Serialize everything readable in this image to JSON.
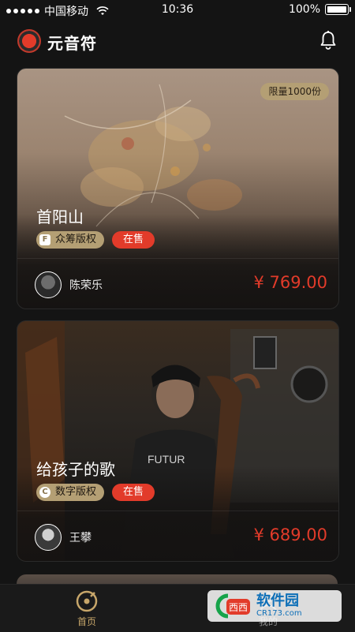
{
  "status_bar": {
    "carrier": "中国移动",
    "time": "10:36",
    "battery": "100%"
  },
  "header": {
    "app_name": "元音符"
  },
  "cards": [
    {
      "limit_badge": "限量1000份",
      "title": "首阳山",
      "rights_icon": "F",
      "rights_type": "众筹版权",
      "sale_status": "在售",
      "artist": "陈荣乐",
      "price": "¥ 769.00"
    },
    {
      "title": "给孩子的歌",
      "rights_icon": "C",
      "rights_type": "数字版权",
      "sale_status": "在售",
      "artist": "王攀",
      "price": "¥ 689.00"
    }
  ],
  "tabbar": {
    "home_label": "首页",
    "mine_label": "我的"
  },
  "watermark": {
    "main": "软件园",
    "sub": "CR173.com"
  },
  "colors": {
    "accent_red": "#e23b2a",
    "gold": "#b49f74",
    "tab_active": "#c7a66a",
    "background": "#141414"
  },
  "icons": {
    "logo": "vinyl-record-logo",
    "bell": "bell-icon",
    "home": "home-disc-icon",
    "mine": "user-icon"
  }
}
